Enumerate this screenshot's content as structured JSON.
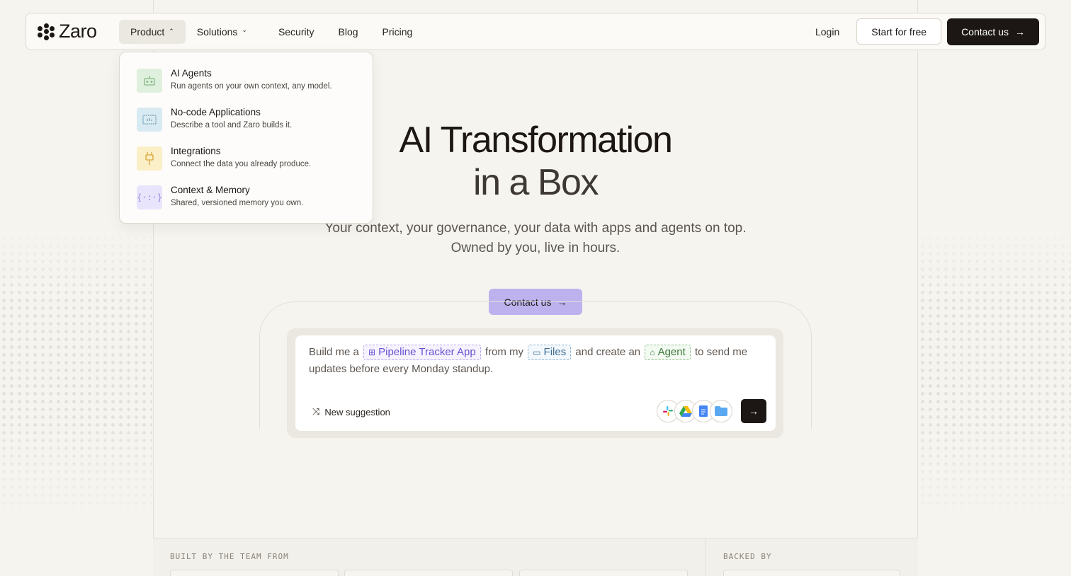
{
  "brand": {
    "name": "Zaro"
  },
  "nav": {
    "items": [
      {
        "label": "Product",
        "has_chevron": true,
        "chevron": "⌃"
      },
      {
        "label": "Solutions",
        "has_chevron": true,
        "chevron": "⌄"
      },
      {
        "label": "Security"
      },
      {
        "label": "Blog"
      },
      {
        "label": "Pricing"
      }
    ],
    "login": "Login",
    "start_free": "Start for free",
    "contact": "Contact us"
  },
  "dropdown": {
    "items": [
      {
        "title": "AI Agents",
        "desc": "Run agents on your own context, any model.",
        "icon": "robot-icon",
        "color": "#dff0de"
      },
      {
        "title": "No-code Applications",
        "desc": "Describe a tool and Zaro builds it.",
        "icon": "app-window-icon",
        "color": "#d9ebf2"
      },
      {
        "title": "Integrations",
        "desc": "Connect the data you already produce.",
        "icon": "plug-icon",
        "color": "#fbefc7"
      },
      {
        "title": "Context & Memory",
        "desc": "Shared, versioned memory you own.",
        "icon": "braces-icon",
        "color": "#e8e4fb"
      }
    ]
  },
  "hero": {
    "title_line1": "AI Transformation",
    "title_line2": "in a Box",
    "subtitle_line1": "Your context, your governance, your data with apps and agents on top.",
    "subtitle_line2": "Owned by you, live in hours.",
    "cta": "Contact us"
  },
  "prompt": {
    "t1": "Build me a",
    "chip1": "Pipeline Tracker App",
    "t2": "from my",
    "chip2": "Files",
    "t3": "and create an",
    "chip3": "Agent",
    "t4": "to send me updates before every Monday standup.",
    "new_suggestion": "New suggestion",
    "apps": [
      "slack-icon",
      "google-drive-icon",
      "google-docs-icon",
      "folder-icon"
    ]
  },
  "band": {
    "built_by": "BUILT BY THE TEAM FROM",
    "backed_by": "BACKED BY"
  },
  "colors": {
    "accent": "#bdb2ee",
    "dark": "#1c1714",
    "background": "#f6f4ef"
  }
}
